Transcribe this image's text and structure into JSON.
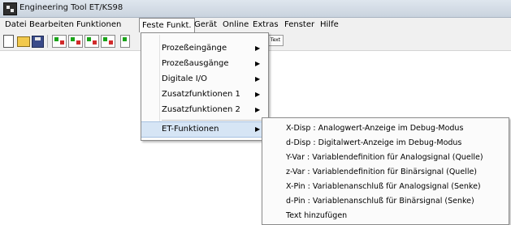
{
  "window": {
    "title": "Engineering Tool ET/KS98"
  },
  "menubar": {
    "items": [
      "Datei",
      "Bearbeiten",
      "Funktionen",
      "Feste Funkt.",
      "Gerät",
      "Online",
      "Extras",
      "Fenster",
      "Hilfe"
    ],
    "active": "Feste Funkt."
  },
  "toolbar": {
    "icons": [
      "new-file-icon",
      "open-folder-icon",
      "save-icon",
      "signal-icon-1",
      "signal-icon-2",
      "signal-icon-3",
      "signal-icon-4"
    ],
    "text_button": "Text"
  },
  "dropdown": {
    "items": [
      {
        "label": "Prozeßeingänge",
        "submenu": true
      },
      {
        "label": "Prozeßausgänge",
        "submenu": true
      },
      {
        "label": "Digitale I/O",
        "submenu": true
      },
      {
        "label": "Zusatzfunktionen 1",
        "submenu": true
      },
      {
        "label": "Zusatzfunktionen 2",
        "submenu": true
      },
      {
        "label": "ET-Funktionen",
        "submenu": true,
        "highlighted": true
      }
    ],
    "arrow": "▶"
  },
  "submenu": {
    "items": [
      "X-Disp : Analogwert-Anzeige im Debug-Modus",
      "d-Disp : Digitalwert-Anzeige im Debug-Modus",
      "Y-Var : Variablendefinition für Analogsignal (Quelle)",
      "z-Var : Variablendefinition für Binärsignal (Quelle)",
      "X-Pin : Variablenanschluß für Analogsignal (Senke)",
      "d-Pin : Variablenanschluß für Binärsignal (Senke)",
      "Text hinzufügen"
    ]
  },
  "colors": {
    "highlight": "#d6e5f5",
    "menu_bg": "#fbfbfb",
    "bar_bg": "#f0f0f0"
  }
}
